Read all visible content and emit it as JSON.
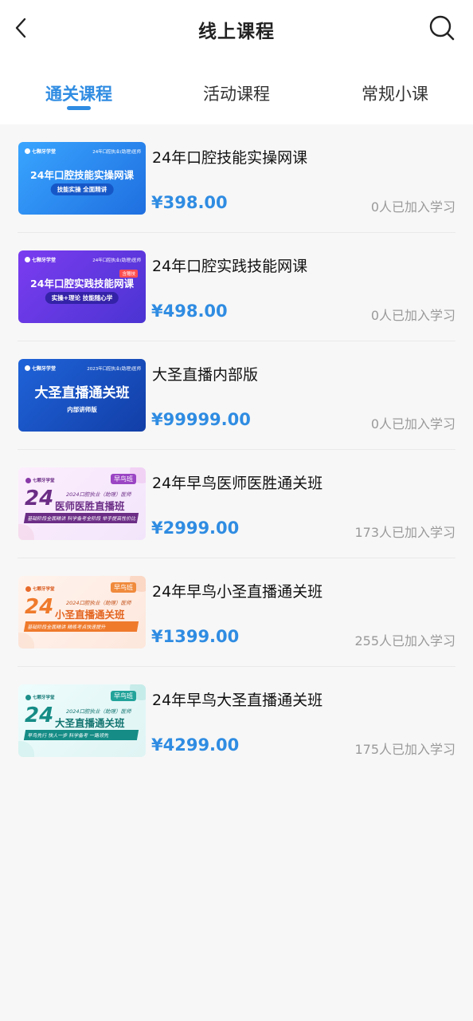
{
  "header": {
    "title": "线上课程"
  },
  "tabs": [
    {
      "label": "通关课程",
      "active": true
    },
    {
      "label": "活动课程",
      "active": false
    },
    {
      "label": "常规小课",
      "active": false
    }
  ],
  "courses": [
    {
      "name": "24年口腔技能实操网课",
      "price": "¥398.00",
      "enrolled": "0人已加入学习",
      "thumb": {
        "logo": "七颗牙学堂",
        "tag": "24年口腔执业(助理)医师",
        "title": "24年口腔技能实操网课",
        "sub": "技能实操 全面精讲"
      }
    },
    {
      "name": "24年口腔实践技能网课",
      "price": "¥498.00",
      "enrolled": "0人已加入学习",
      "thumb": {
        "logo": "七颗牙学堂",
        "tag": "24年口腔执业(助理)医师",
        "badge": "含赠技",
        "title": "24年口腔实践技能网课",
        "sub": "实操+理论 技能随心学"
      }
    },
    {
      "name": "大圣直播内部版",
      "price": "¥99999.00",
      "enrolled": "0人已加入学习",
      "thumb": {
        "logo": "七颗牙学堂",
        "tag": "2023年口腔执业(助理)医师",
        "title": "大圣直播通关班",
        "sub": "内部讲师版"
      }
    },
    {
      "name": "24年早鸟医师医胜通关班",
      "price": "¥2999.00",
      "enrolled": "173人已加入学习",
      "thumb": {
        "logo": "七颗牙学堂",
        "badge": "早鸟班",
        "num": "24",
        "line1": "2024口腔执业（助理）医师",
        "line2": "医师医胜直播班",
        "bar": "基础阶段全面精讲 科学备考全阶段 举手提高性价比"
      }
    },
    {
      "name": "24年早鸟小圣直播通关班",
      "price": "¥1399.00",
      "enrolled": "255人已加入学习",
      "thumb": {
        "logo": "七颗牙学堂",
        "badge": "早鸟班",
        "num": "24",
        "line1": "2024口腔执业（助理）医师",
        "line2": "小圣直播通关班",
        "bar": "基础阶段全面精讲 精练考点快速提升"
      }
    },
    {
      "name": "24年早鸟大圣直播通关班",
      "price": "¥4299.00",
      "enrolled": "175人已加入学习",
      "thumb": {
        "logo": "七颗牙学堂",
        "badge": "早鸟班",
        "num": "24",
        "line1": "2024口腔执业（助理）医师",
        "line2": "大圣直播通关班",
        "bar": "早鸟先行 快人一步 科学备考 一路领先"
      }
    }
  ],
  "colors": {
    "accent": "#2f8ce2",
    "text": "#111111",
    "muted": "#9a9a9a",
    "background": "#f7f7f7"
  },
  "icons": {
    "back": "chevron-left",
    "search": "magnifier"
  }
}
